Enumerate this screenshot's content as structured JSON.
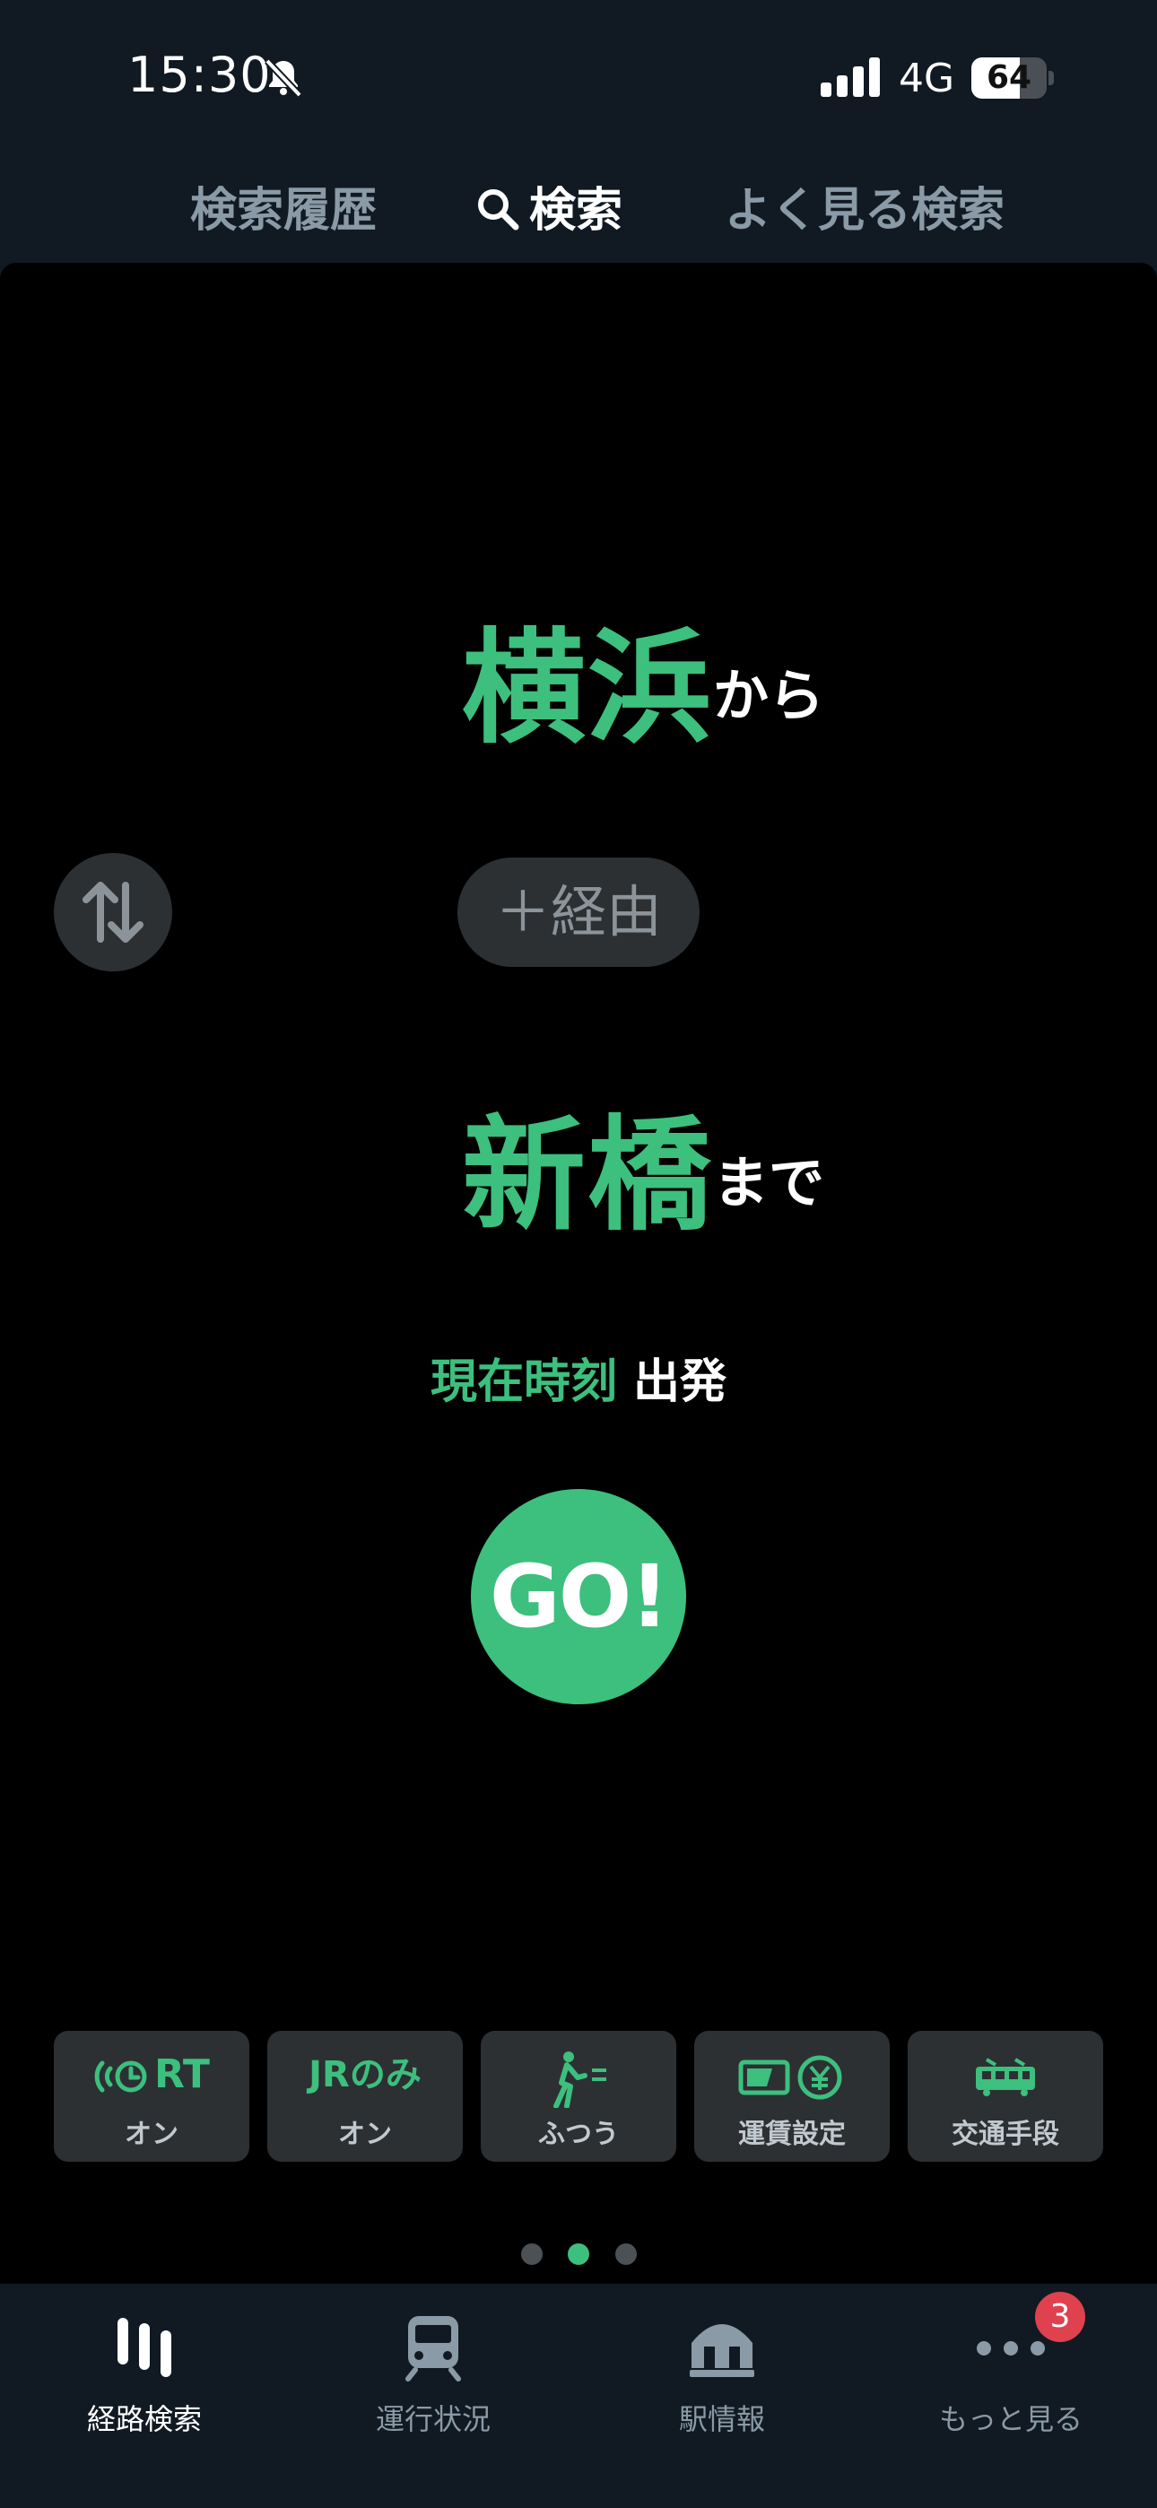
{
  "status_bar": {
    "time": "15:30",
    "network": "4G",
    "battery": "64",
    "battery_level_percent": 64
  },
  "tabs": {
    "history": "検索履歴",
    "search": "検索",
    "favorites": "よく見る検索"
  },
  "route": {
    "from_station": "横浜",
    "from_suffix": "から",
    "via_label": "＋経由",
    "to_station": "新橋",
    "to_suffix": "まで"
  },
  "time": {
    "when": "現在時刻",
    "type": "出発"
  },
  "go_label": "GO!",
  "options": [
    {
      "top": "RT",
      "label": "オン"
    },
    {
      "top": "JRのみ",
      "label": "オン"
    },
    {
      "label": "ふつう"
    },
    {
      "label": "運賃設定"
    },
    {
      "label": "交通手段"
    }
  ],
  "page_indicator": {
    "pages": 3,
    "active": 2
  },
  "nav": {
    "route_search": "経路検索",
    "service_status": "運行状況",
    "station_info": "駅情報",
    "more": "もっと見る",
    "more_badge": "3"
  },
  "colors": {
    "accent": "#3dbf7e",
    "background": "#000000",
    "chrome": "#111a22",
    "badge": "#e0414e"
  }
}
